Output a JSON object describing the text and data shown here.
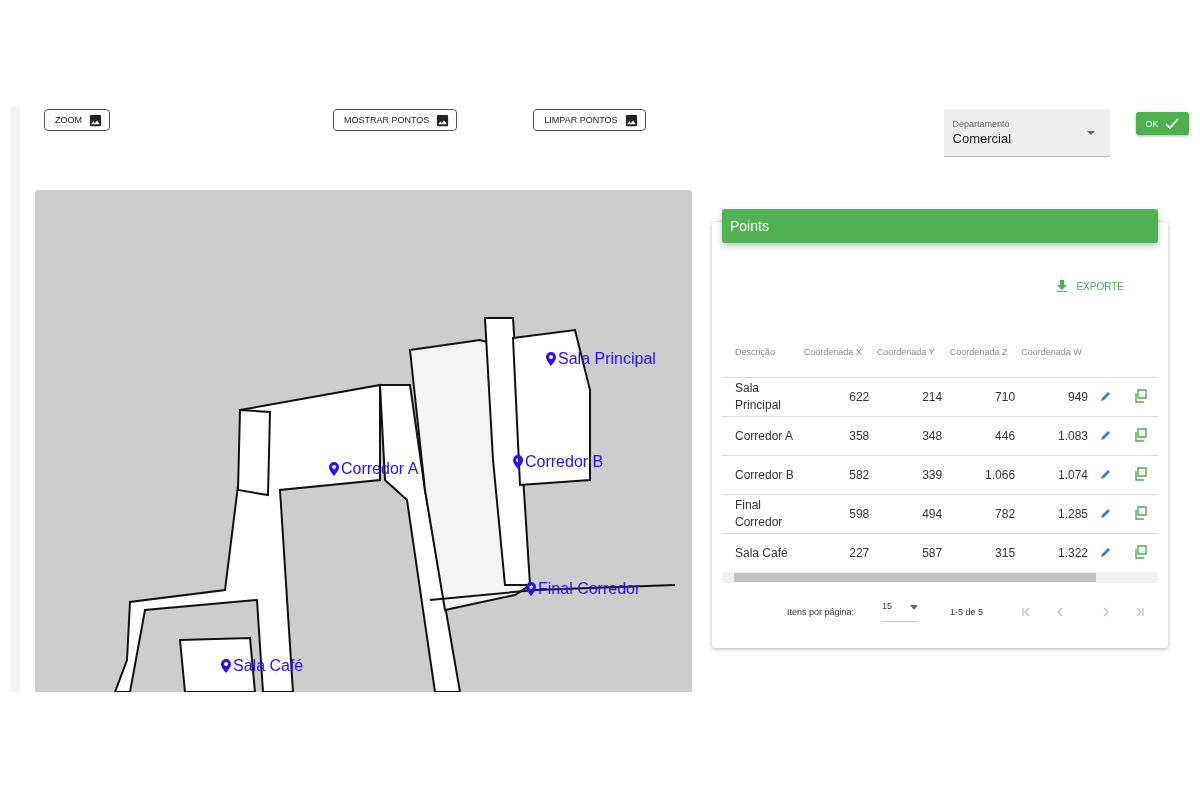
{
  "toolbar": {
    "buttons": [
      {
        "label": "ZOOM"
      },
      {
        "label": "MOSTRAR PONTOS"
      },
      {
        "label": "LIMPAR PONTOS"
      }
    ],
    "department": {
      "label": "Departamento",
      "value": "Comercial"
    },
    "ok_button": "OK"
  },
  "map": {
    "pins": [
      {
        "label": "Sala Principal"
      },
      {
        "label": "Corredor A"
      },
      {
        "label": "Corredor B"
      },
      {
        "label": "Final Corredor"
      },
      {
        "label": "Sala Café"
      }
    ]
  },
  "points_card": {
    "title": "Points",
    "export_button": "EXPORTE",
    "table": {
      "columns": [
        "Descrição",
        "Coordenada X",
        "Coordenada Y",
        "Coordenada Z",
        "Coordenada W"
      ],
      "rows": [
        {
          "cells": [
            "Sala Principal",
            "622",
            "214",
            "710",
            "949"
          ]
        },
        {
          "cells": [
            "Corredor A",
            "358",
            "348",
            "446",
            "1.083"
          ]
        },
        {
          "cells": [
            "Corredor B",
            "582",
            "339",
            "1.066",
            "1.074"
          ]
        },
        {
          "cells": [
            "Final Corredor",
            "598",
            "494",
            "782",
            "1.285"
          ]
        },
        {
          "cells": [
            "Sala Café",
            "227",
            "587",
            "315",
            "1.322"
          ]
        }
      ]
    },
    "paginator": {
      "items_label": "Itens por página:",
      "page_size": "15",
      "range": "1-5 de 5"
    }
  }
}
